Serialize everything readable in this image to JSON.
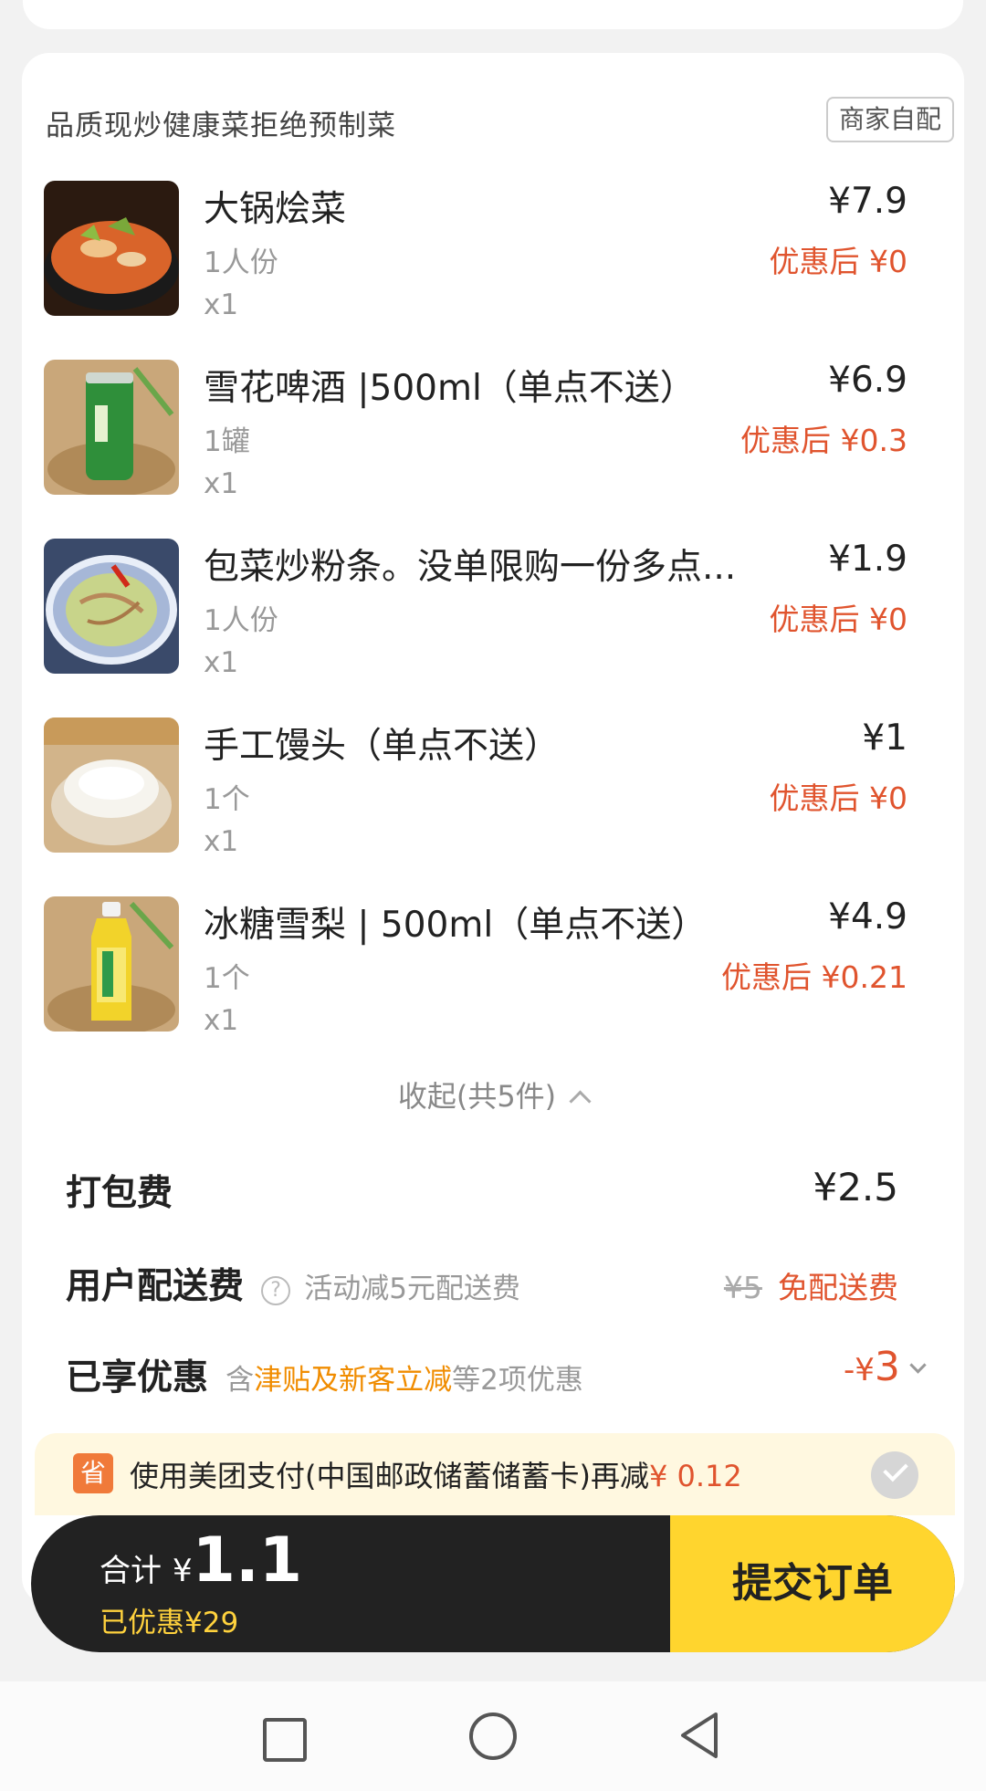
{
  "store": {
    "tagline": "品质现炒健康菜拒绝预制菜",
    "delivery_badge": "商家自配"
  },
  "items": [
    {
      "name": "大锅烩菜",
      "spec": "1人份",
      "qty": "x1",
      "price": "¥7.9",
      "discounted": "优惠后 ¥0",
      "thumb_icon": "stew-dish-photo"
    },
    {
      "name": "雪花啤酒 |500ml（单点不送）",
      "spec": "1罐",
      "qty": "x1",
      "price": "¥6.9",
      "discounted": "优惠后 ¥0.3",
      "thumb_icon": "beer-can-photo"
    },
    {
      "name": "包菜炒粉条。没单限购一份多点...",
      "spec": "1人份",
      "qty": "x1",
      "price": "¥1.9",
      "discounted": "优惠后 ¥0",
      "thumb_icon": "cabbage-noodles-photo"
    },
    {
      "name": "手工馒头（单点不送）",
      "spec": "1个",
      "qty": "x1",
      "price": "¥1",
      "discounted": "优惠后 ¥0",
      "thumb_icon": "steamed-bun-photo"
    },
    {
      "name": "冰糖雪梨 | 500ml（单点不送）",
      "spec": "1个",
      "qty": "x1",
      "price": "¥4.9",
      "discounted": "优惠后 ¥0.21",
      "thumb_icon": "pear-drink-bottle-photo"
    }
  ],
  "collapse_label": "收起(共5件)",
  "fees": {
    "packing_label": "打包费",
    "packing_value": "¥2.5",
    "delivery_label": "用户配送费",
    "delivery_note": "活动减5元配送费",
    "delivery_original": "¥5",
    "delivery_value": "免配送费",
    "discount_label": "已享优惠",
    "discount_note_prefix": "含",
    "discount_note_highlight": "津贴及新客立减",
    "discount_note_suffix": "等2项优惠",
    "discount_value_prefix": "-¥",
    "discount_value": "3"
  },
  "promo": {
    "icon_text": "省",
    "text": "使用美团支付(中国邮政储蓄储蓄卡)再减",
    "amount": "¥ 0.12"
  },
  "checkout": {
    "total_label": "合计",
    "currency": "¥",
    "total_value": "1.1",
    "saved_text": "已优惠¥29",
    "submit_label": "提交订单"
  },
  "colors": {
    "accent_red": "#e0542e",
    "accent_orange": "#f08c00",
    "checkout_dark": "#222222",
    "submit_yellow": "#ffd52e",
    "saved_yellow": "#ffd23d"
  }
}
